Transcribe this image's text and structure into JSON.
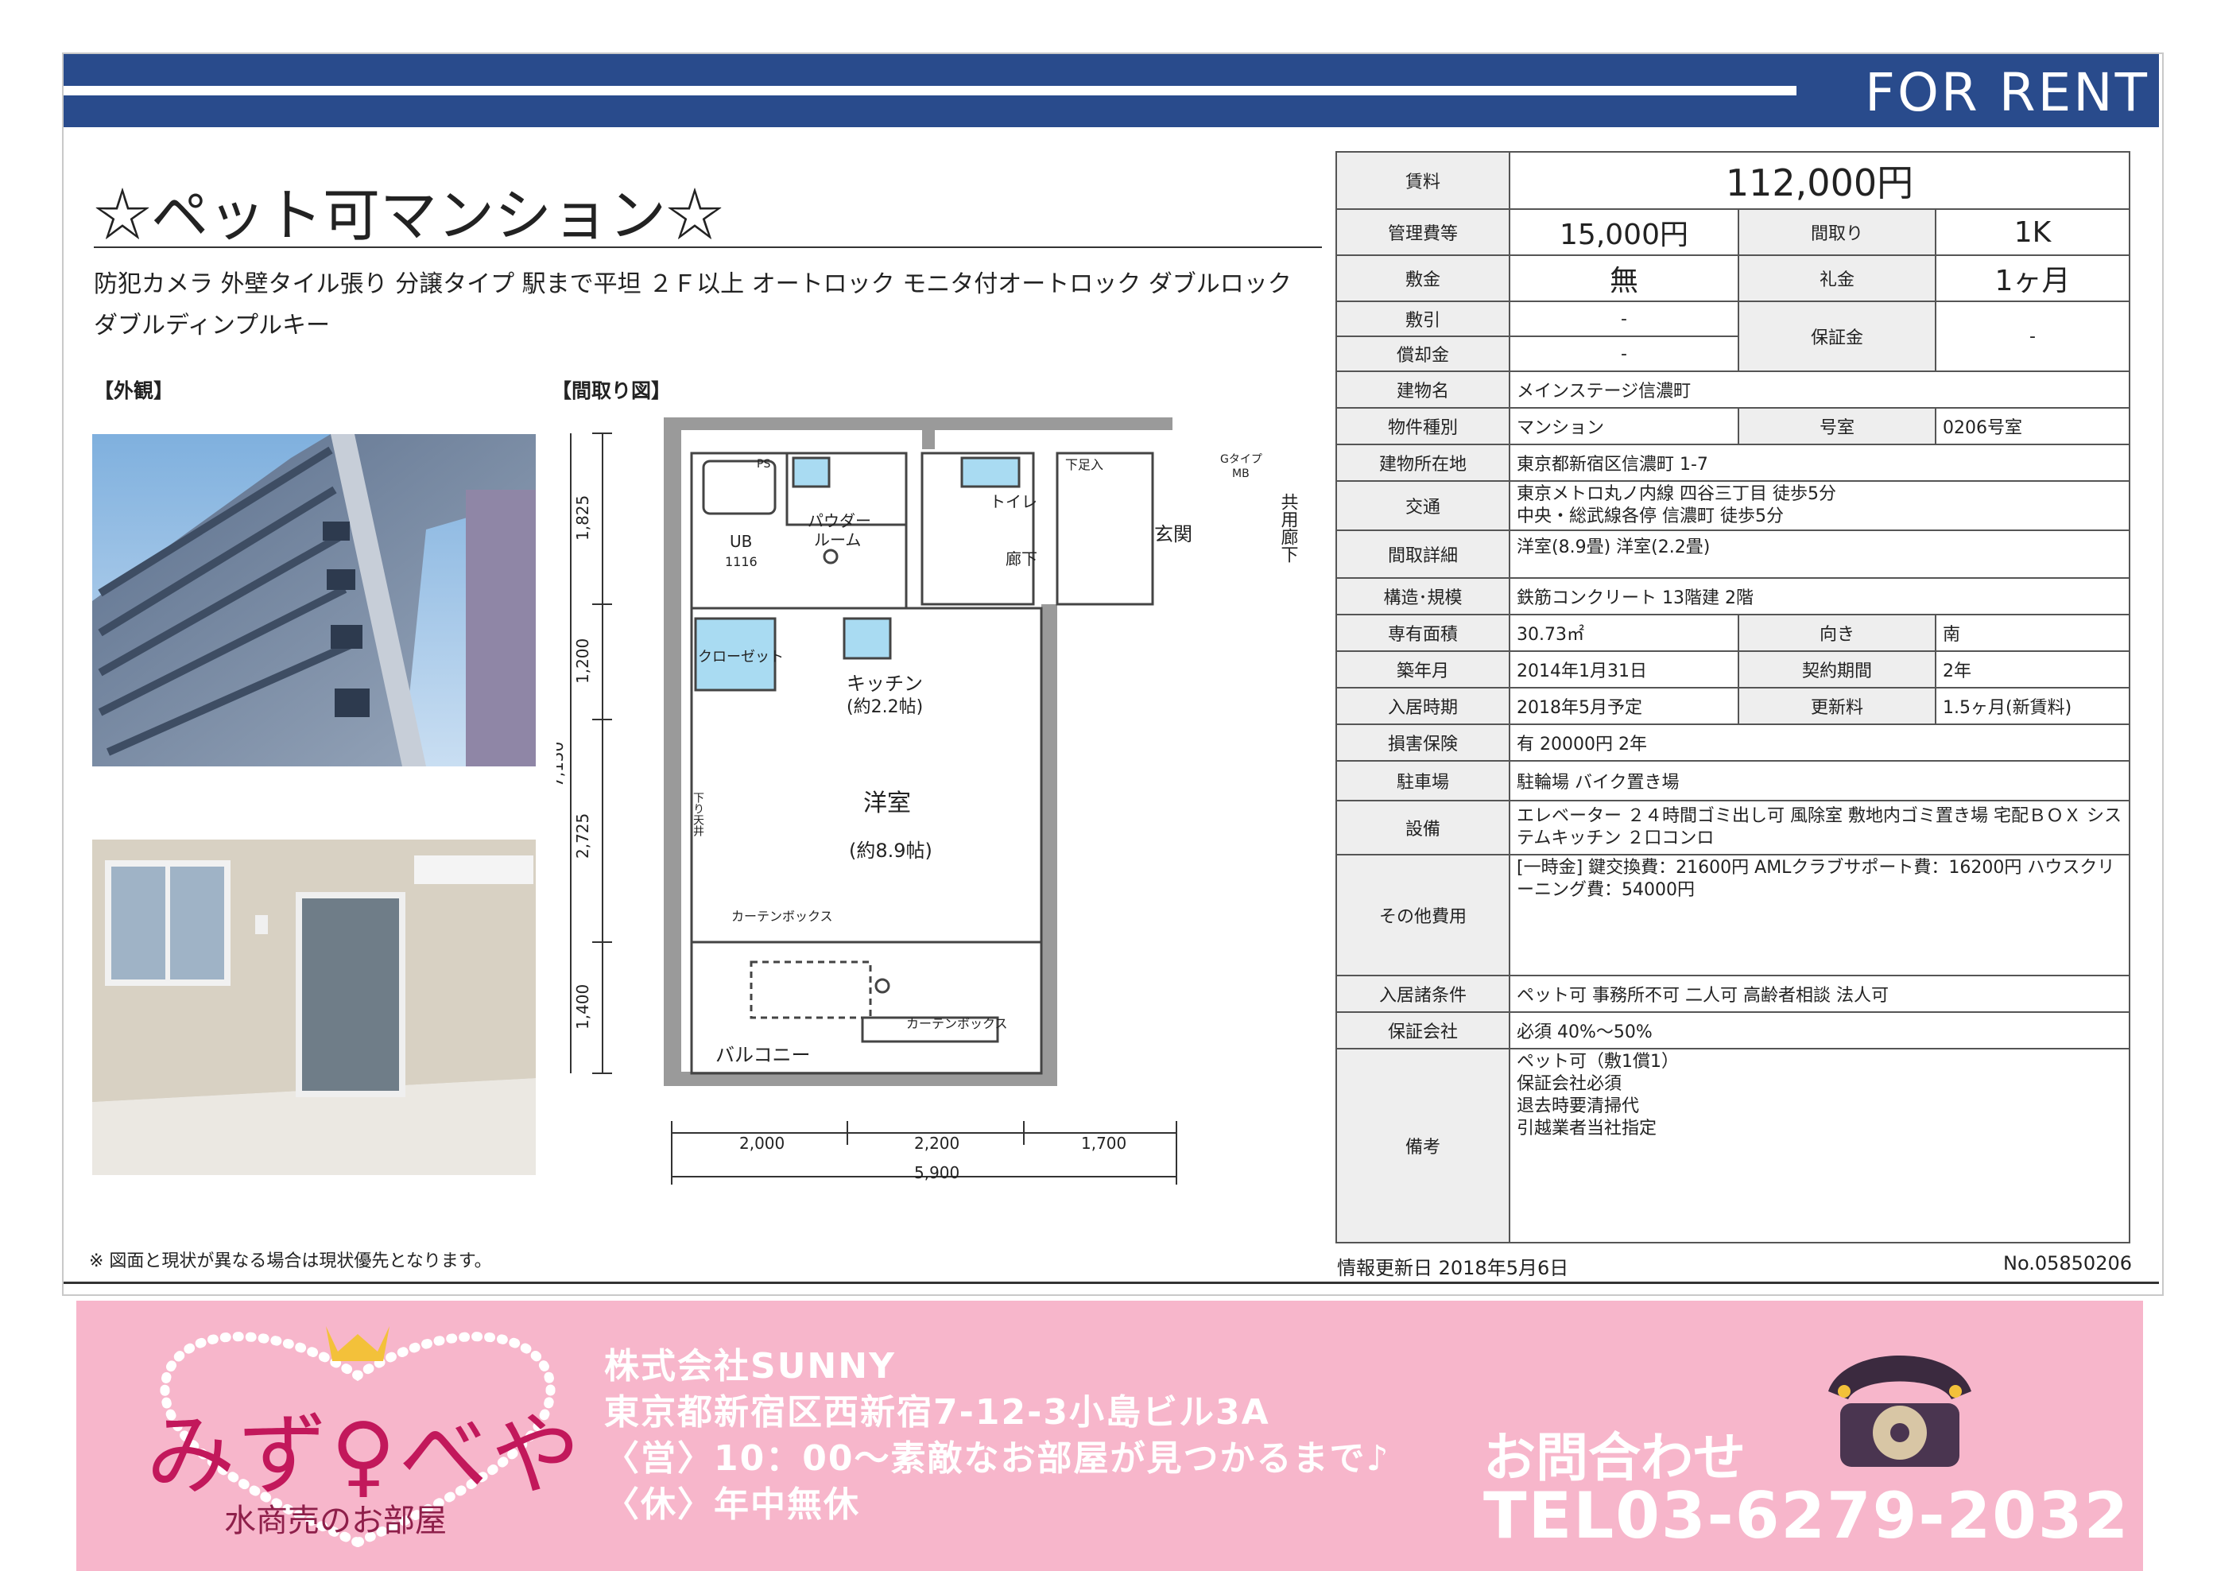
{
  "header": {
    "banner": "FOR RENT"
  },
  "property": {
    "title": "☆ペット可マンション☆",
    "features": "防犯カメラ 外壁タイル張り 分譲タイプ 駅まで平坦 ２Ｆ以上 オートロック モニタ付オートロック ダブルロック ダブルディンプルキー"
  },
  "sections": {
    "exterior": "【外観】",
    "floorplan": "【間取り図】"
  },
  "floorplan": {
    "rooms": {
      "ub": "UB",
      "ub_no": "1116",
      "powder": "パウダー",
      "powder2": "ルーム",
      "toilet": "トイレ",
      "hall": "廊下",
      "entrance": "玄関",
      "shared": "共用廊下",
      "closet": "クローゼット",
      "kitchen": "キッチン",
      "kitchen_size": "(約2.2帖)",
      "western": "洋室",
      "western_size": "(約8.9帖)",
      "balcony": "バルコニー",
      "curtain1": "カーテンボックス",
      "curtain2": "カーテンボックス",
      "shoe": "下足入",
      "gtype": "Gタイプ",
      "mb": "MB",
      "ps": "PS",
      "drop": "下り天井"
    },
    "dims": {
      "v1": "1,825",
      "v2": "1,200",
      "v3": "2,725",
      "v4": "1,400",
      "vt": "7,150",
      "h1": "2,000",
      "h2": "2,200",
      "h3": "1,700",
      "ht": "5,900"
    }
  },
  "spec": {
    "rent_label": "賃料",
    "rent": "112,000円",
    "mgmt_label": "管理費等",
    "mgmt": "15,000円",
    "layout_label": "間取り",
    "layout": "1K",
    "deposit_label": "敷金",
    "deposit": "無",
    "keymoney_label": "礼金",
    "keymoney": "1ヶ月",
    "shikibiki_label": "敷引",
    "shikibiki": "-",
    "shokyaku_label": "償却金",
    "shokyaku": "-",
    "guarantee_money_label": "保証金",
    "guarantee_money": "-",
    "building_label": "建物名",
    "building": "メインステージ信濃町",
    "type_label": "物件種別",
    "type": "マンション",
    "room_label": "号室",
    "room": "0206号室",
    "address_label": "建物所在地",
    "address": "東京都新宿区信濃町 1-7",
    "access_label": "交通",
    "access1": "東京メトロ丸ノ内線 四谷三丁目 徒歩5分",
    "access2": "中央・総武線各停 信濃町 徒歩5分",
    "detail_label": "間取詳細",
    "detail": "洋室(8.9畳) 洋室(2.2畳)",
    "structure_label": "構造･規模",
    "structure": "鉄筋コンクリート 13階建 2階",
    "area_label": "専有面積",
    "area": "30.73㎡",
    "direction_label": "向き",
    "direction": "南",
    "built_label": "築年月",
    "built": "2014年1月31日",
    "contract_label": "契約期間",
    "contract": "2年",
    "movein_label": "入居時期",
    "movein": "2018年5月予定",
    "renewal_label": "更新料",
    "renewal": "1.5ヶ月(新賃料)",
    "insurance_label": "損害保険",
    "insurance": "有 20000円 2年",
    "parking_label": "駐車場",
    "parking": "駐輪場 バイク置き場",
    "equipment_label": "設備",
    "equipment": "エレベーター ２４時間ゴミ出し可 風除室 敷地内ゴミ置き場 宅配ＢＯＸ システムキッチン ２口コンロ",
    "other_label": "その他費用",
    "other": "[一時金] 鍵交換費：21600円 AMLクラブサポート費：16200円 ハウスクリーニング費：54000円",
    "conditions_label": "入居諸条件",
    "conditions": "ペット可 事務所不可 二人可 高齢者相談 法人可",
    "guarantor_label": "保証会社",
    "guarantor": "必須 40%～50%",
    "remarks_label": "備考",
    "remarks": [
      "ペット可（敷1償1）",
      "保証会社必須",
      "退去時要清掃代",
      "引越業者当社指定"
    ]
  },
  "notes": {
    "disclaimer": "※ 図面と現状が異なる場合は現状優先となります。",
    "updated": "情報更新日 2018年5月6日",
    "number": "No.05850206"
  },
  "footer": {
    "logo": "みず♀べや",
    "logo_sub": "水商売のお部屋",
    "company": "株式会社SUNNY",
    "company_address": "東京都新宿区西新宿7-12-3小島ビル3A",
    "hours": "〈営〉10：00～素敵なお部屋が見つかるまで♪",
    "holiday": "〈休〉年中無休",
    "contact": "お問合わせ",
    "tel": "TEL03-6279-2032",
    "colors": {
      "banner": "#294b8c",
      "footer": "#f7b6cb",
      "logo": "#c2185b"
    }
  }
}
